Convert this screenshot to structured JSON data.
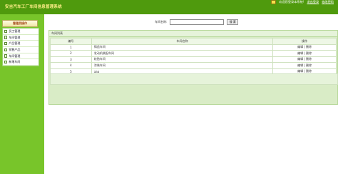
{
  "header": {
    "title": "安吉汽车工厂车间信息管理系统",
    "welcome": "欢迎您登录本系统!",
    "links": [
      "退出登录",
      "修改密码"
    ]
  },
  "sidebar": {
    "header": "管理员操作",
    "items": [
      "员工管理",
      "车间管理",
      "产品管理",
      "销售产品",
      "车间管理",
      "新增车间"
    ]
  },
  "search": {
    "label": "车间名称:",
    "value": "",
    "button": "搜 索"
  },
  "list": {
    "title": "车间列表",
    "columns": [
      "编号",
      "车间名称",
      "操作"
    ],
    "rows": [
      {
        "id": "1",
        "name": "铸造车间",
        "ops": [
          "编辑",
          "删除"
        ]
      },
      {
        "id": "2",
        "name": "发动机装配车间",
        "ops": [
          "编辑",
          "删除"
        ]
      },
      {
        "id": "3",
        "name": "轮胎车间",
        "ops": [
          "编辑",
          "删除"
        ]
      },
      {
        "id": "4",
        "name": "涂装车间",
        "ops": [
          "编辑",
          "删除"
        ]
      },
      {
        "id": "5",
        "name": "aaa",
        "ops": [
          "编辑",
          "删除"
        ]
      }
    ]
  },
  "colors": {
    "topbar": "#4f9a0d",
    "sidebar": "#78c52a",
    "panel": "#d9ecc6",
    "title": "#ffee88"
  },
  "icons": [
    "flag-icon",
    "bullet-icon"
  ]
}
